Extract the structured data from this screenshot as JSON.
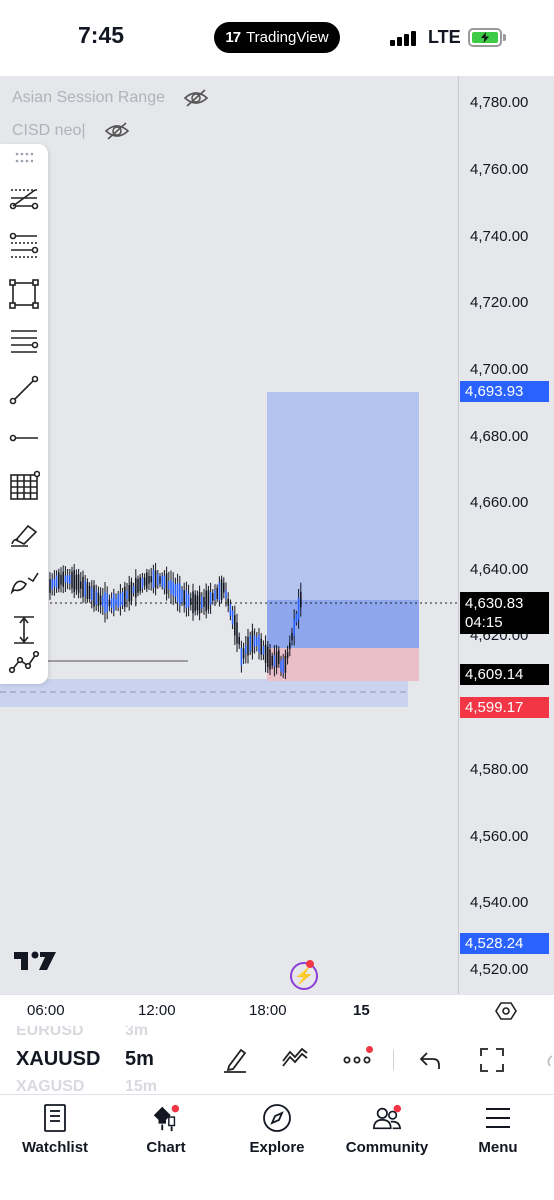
{
  "status_bar": {
    "time": "7:45",
    "app_pill": "TradingView",
    "network": "LTE"
  },
  "indicators": [
    {
      "name": "Asian Session Range",
      "visibility_icon": "eye-off-icon"
    },
    {
      "name": "CISD neo|",
      "visibility_icon": "eye-off-icon"
    }
  ],
  "price_scale": {
    "ticks": [
      "4,780.00",
      "4,760.00",
      "4,740.00",
      "4,720.00",
      "4,700.00",
      "4,680.00",
      "4,660.00",
      "4,640.00",
      "4,620.00",
      "4,580.00",
      "4,560.00",
      "4,540.00",
      "4,520.00"
    ],
    "labels": {
      "target": "4,693.93",
      "current_price": "4,630.83",
      "countdown": "04:15",
      "entry": "4,609.14",
      "stop": "4,599.17",
      "low": "4,528.24"
    }
  },
  "time_axis": {
    "ticks": [
      "06:00",
      "12:00",
      "18:00",
      "15"
    ]
  },
  "drawing_tools": [
    "trend-line-tools-icon",
    "fib-retracement-icon",
    "rectangle-icon",
    "horizontal-lines-icon",
    "trend-line-icon",
    "horizontal-ray-icon",
    "grid-icon",
    "brush-icon",
    "curve-icon",
    "measure-icon",
    "path-icon"
  ],
  "symbol_bar": {
    "symbol": "XAUUSD",
    "interval": "5m",
    "ghost_above_symbol": "EURUSD",
    "ghost_above_interval": "3m",
    "ghost_below_symbol": "XAGUSD",
    "ghost_below_interval": "15m"
  },
  "bottom_nav": [
    {
      "label": "Watchlist",
      "icon": "book-icon"
    },
    {
      "label": "Chart",
      "icon": "candles-icon"
    },
    {
      "label": "Explore",
      "icon": "compass-icon"
    },
    {
      "label": "Community",
      "icon": "people-icon"
    },
    {
      "label": "Menu",
      "icon": "hamburger-icon"
    }
  ],
  "colors": {
    "accent_blue": "#2962ff",
    "sell_red": "#f23645",
    "chart_bg": "#e6e7eb",
    "target_zone": "#b4c4ef",
    "stop_zone": "#ebbfc8"
  }
}
